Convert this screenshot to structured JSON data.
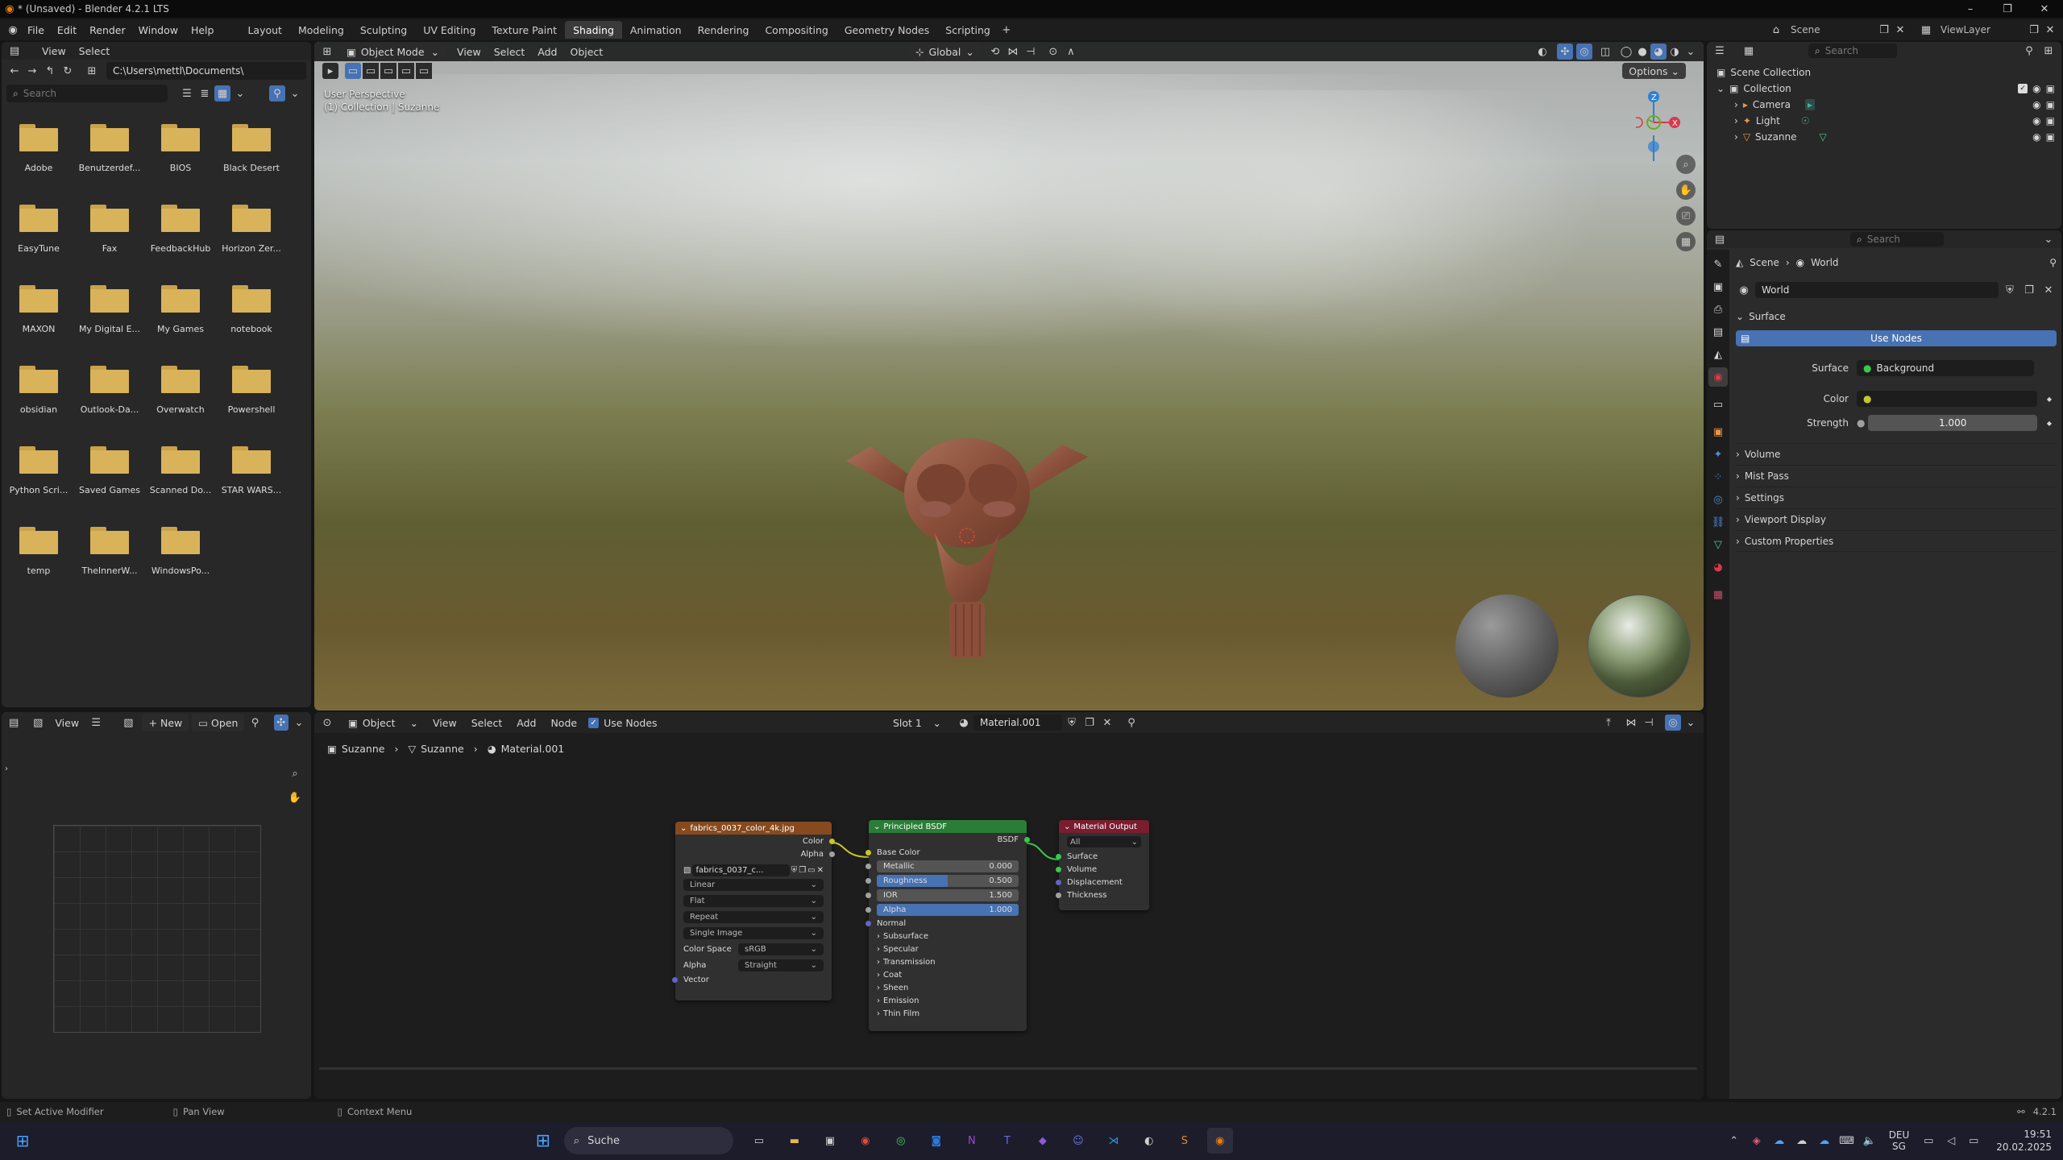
{
  "window": {
    "title": "* (Unsaved) - Blender 4.2.1 LTS"
  },
  "topbar": {
    "menus": [
      "File",
      "Edit",
      "Render",
      "Window",
      "Help"
    ],
    "workspaces": [
      "Layout",
      "Modeling",
      "Sculpting",
      "UV Editing",
      "Texture Paint",
      "Shading",
      "Animation",
      "Rendering",
      "Compositing",
      "Geometry Nodes",
      "Scripting"
    ],
    "active_workspace": "Shading",
    "scene": "Scene",
    "view_layer": "ViewLayer"
  },
  "file_browser": {
    "menus": [
      "View",
      "Select"
    ],
    "path": "C:\\Users\\mettl\\Documents\\",
    "search_placeholder": "Search",
    "folders": [
      "Adobe",
      "Benutzerdef...",
      "BIOS",
      "Black Desert",
      "EasyTune",
      "Fax",
      "FeedbackHub",
      "Horizon Zer...",
      "MAXON",
      "My Digital E...",
      "My Games",
      "notebook",
      "obsidian",
      "Outlook-Da...",
      "Overwatch",
      "Powershell",
      "Python Scri...",
      "Saved Games",
      "Scanned Do...",
      "STAR WARS...",
      "temp",
      "TheInnerW...",
      "WindowsPo..."
    ]
  },
  "viewport": {
    "mode": "Object Mode",
    "menus": [
      "View",
      "Select",
      "Add",
      "Object"
    ],
    "transform": "Global",
    "options": "Options",
    "overlay_line1": "User Perspective",
    "overlay_line2": "(1) Collection | Suzanne"
  },
  "image_editor": {
    "view": "View",
    "new": "New",
    "open": "Open"
  },
  "node_editor": {
    "type": "Object",
    "menus": [
      "View",
      "Select",
      "Add",
      "Node"
    ],
    "use_nodes": "Use Nodes",
    "slot": "Slot 1",
    "material": "Material.001",
    "breadcrumb": [
      "Suzanne",
      "Suzanne",
      "Material.001"
    ]
  },
  "nodes": {
    "image": {
      "title": "fabrics_0037_color_4k.jpg",
      "out_color": "Color",
      "out_alpha": "Alpha",
      "file": "fabrics_0037_c...",
      "interp": "Linear",
      "proj": "Flat",
      "ext": "Repeat",
      "source": "Single Image",
      "cs_label": "Color Space",
      "cs_value": "sRGB",
      "alpha_label": "Alpha",
      "alpha_value": "Straight",
      "vector": "Vector"
    },
    "bsdf": {
      "title": "Principled BSDF",
      "out": "BSDF",
      "base_color": "Base Color",
      "metallic": "Metallic",
      "metallic_v": "0.000",
      "roughness": "Roughness",
      "roughness_v": "0.500",
      "roughness_fill": 0.5,
      "ior": "IOR",
      "ior_v": "1.500",
      "alpha": "Alpha",
      "alpha_v": "1.000",
      "normal": "Normal",
      "panels": [
        "Subsurface",
        "Specular",
        "Transmission",
        "Coat",
        "Sheen",
        "Emission",
        "Thin Film"
      ]
    },
    "output": {
      "title": "Material Output",
      "target": "All",
      "inputs": [
        "Surface",
        "Volume",
        "Displacement",
        "Thickness"
      ]
    }
  },
  "outliner": {
    "search_placeholder": "Search",
    "root": "Scene Collection",
    "collection": "Collection",
    "items": [
      "Camera",
      "Light",
      "Suzanne"
    ]
  },
  "properties": {
    "search_placeholder": "Search",
    "crumb_scene": "Scene",
    "crumb_world": "World",
    "world_name": "World",
    "surface_panel": "Surface",
    "use_nodes": "Use Nodes",
    "surface_label": "Surface",
    "surface_value": "Background",
    "color_label": "Color",
    "strength_label": "Strength",
    "strength_value": "1.000",
    "panels": [
      "Volume",
      "Mist Pass",
      "Settings",
      "Viewport Display",
      "Custom Properties"
    ]
  },
  "statusbar": {
    "left": "Set Active Modifier",
    "mid": "Pan View",
    "right": "Context Menu",
    "version": "4.2.1"
  },
  "taskbar": {
    "search": "Suche",
    "lang1": "DEU",
    "lang2": "SG",
    "time": "19:51",
    "date": "20.02.2025"
  }
}
